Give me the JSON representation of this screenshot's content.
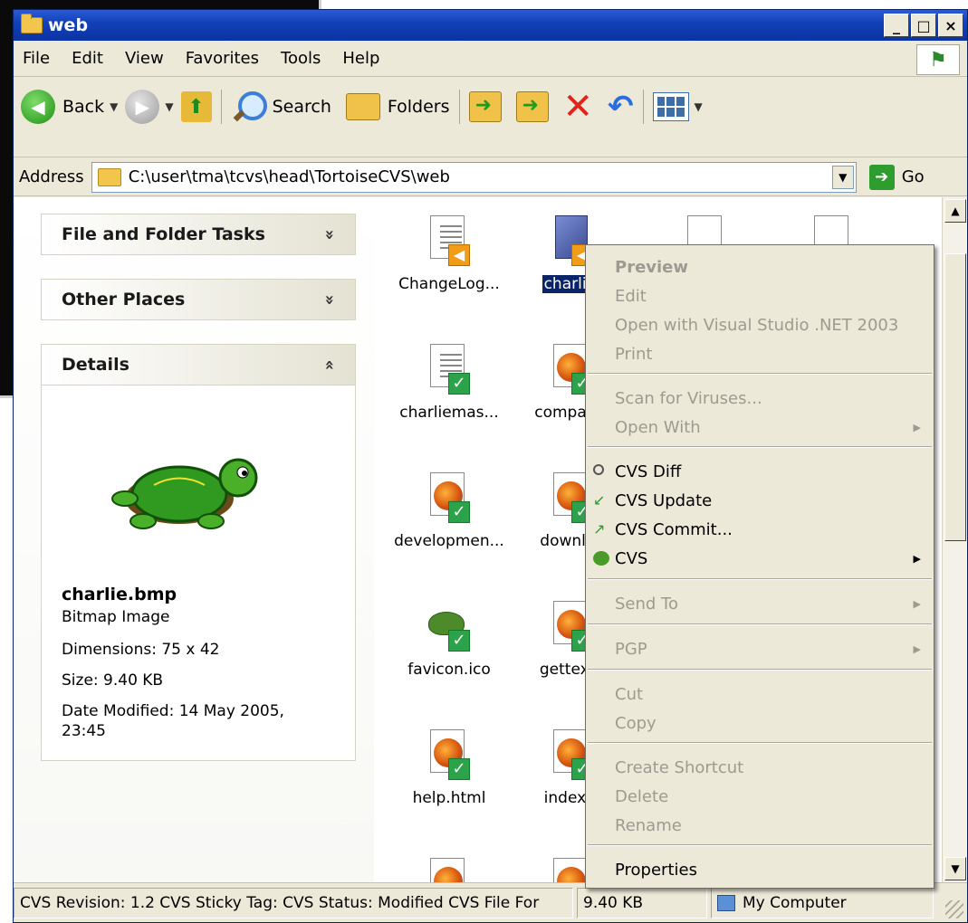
{
  "window": {
    "title": "web",
    "buttons": [
      "_",
      "□",
      "×"
    ]
  },
  "menubar": {
    "items": [
      "File",
      "Edit",
      "View",
      "Favorites",
      "Tools",
      "Help"
    ]
  },
  "toolbar": {
    "back_label": "Back",
    "search_label": "Search",
    "folders_label": "Folders"
  },
  "address": {
    "label": "Address",
    "value": "C:\\user\\tma\\tcvs\\head\\TortoiseCVS\\web",
    "go_label": "Go"
  },
  "taskpane": {
    "file_folder_tasks": "File and Folder Tasks",
    "other_places": "Other Places",
    "details": "Details",
    "chevron_down": "»",
    "chevron_up": "«",
    "detail_name": "charlie.bmp",
    "detail_type": "Bitmap Image",
    "dimensions": "Dimensions: 75 x 42",
    "size": "Size: 9.40 KB",
    "date_modified_line1": "Date Modified: 14 May 2005,",
    "date_modified_line2": "23:45"
  },
  "files": [
    {
      "name": "ChangeLog..."
    },
    {
      "name": "charlie."
    },
    {
      "name": "charliemas..."
    },
    {
      "name": "companie"
    },
    {
      "name": "developmen..."
    },
    {
      "name": "downloa"
    },
    {
      "name": "favicon.ico"
    },
    {
      "name": "gettextg"
    },
    {
      "name": "help.html"
    },
    {
      "name": "index.h"
    }
  ],
  "context_menu": {
    "preview": "Preview",
    "edit": "Edit",
    "open_with_vs": "Open with Visual Studio .NET 2003",
    "print": "Print",
    "scan": "Scan for Viruses...",
    "open_with": "Open With",
    "cvs_diff": "CVS Diff",
    "cvs_update": "CVS Update",
    "cvs_commit": "CVS Commit...",
    "cvs": "CVS",
    "send_to": "Send To",
    "pgp": "PGP",
    "cut": "Cut",
    "copy": "Copy",
    "create_shortcut": "Create Shortcut",
    "delete": "Delete",
    "rename": "Rename",
    "properties": "Properties"
  },
  "statusbar": {
    "info": "CVS Revision: 1.2 CVS Sticky Tag: CVS Status: Modified CVS File For",
    "size": "9.40 KB",
    "location": "My Computer"
  },
  "colors": {
    "titlebar": "#0b33a3",
    "selection": "#0a246a",
    "menu_bg": "#ece9d8",
    "disabled_text": "#9d9b8f"
  }
}
